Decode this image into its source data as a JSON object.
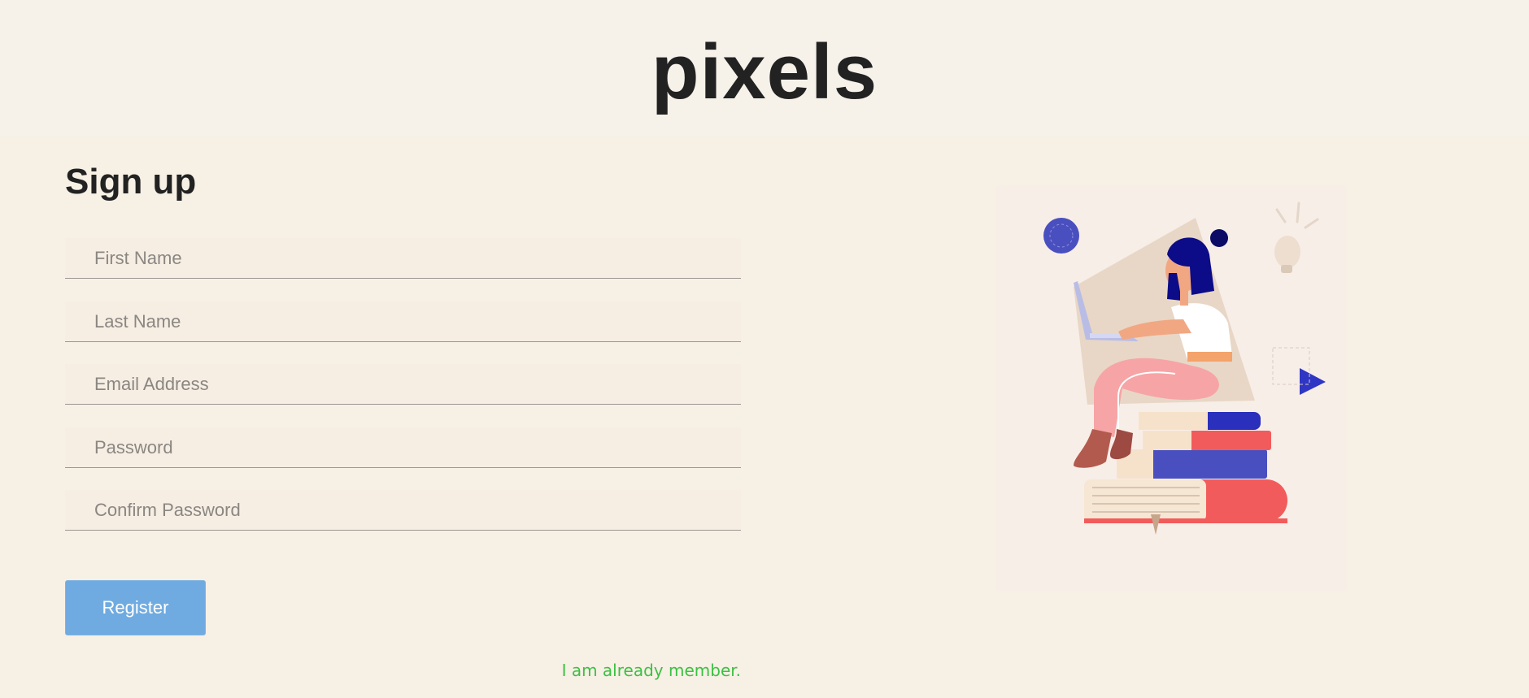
{
  "header": {
    "brand": "pixels"
  },
  "form": {
    "title": "Sign up",
    "fields": [
      {
        "placeholder": "First Name",
        "value": ""
      },
      {
        "placeholder": "Last Name",
        "value": ""
      },
      {
        "placeholder": "Email Address",
        "value": ""
      },
      {
        "placeholder": "Password",
        "value": ""
      },
      {
        "placeholder": "Confirm Password",
        "value": ""
      }
    ],
    "register_label": "Register",
    "login_link": "I am already member."
  },
  "illustration": {
    "icon": "woman-on-books-with-laptop-illustration"
  },
  "colors": {
    "background": "#f7f0e5",
    "button": "#6fabe1",
    "link": "#3cc043",
    "text": "#222222"
  }
}
